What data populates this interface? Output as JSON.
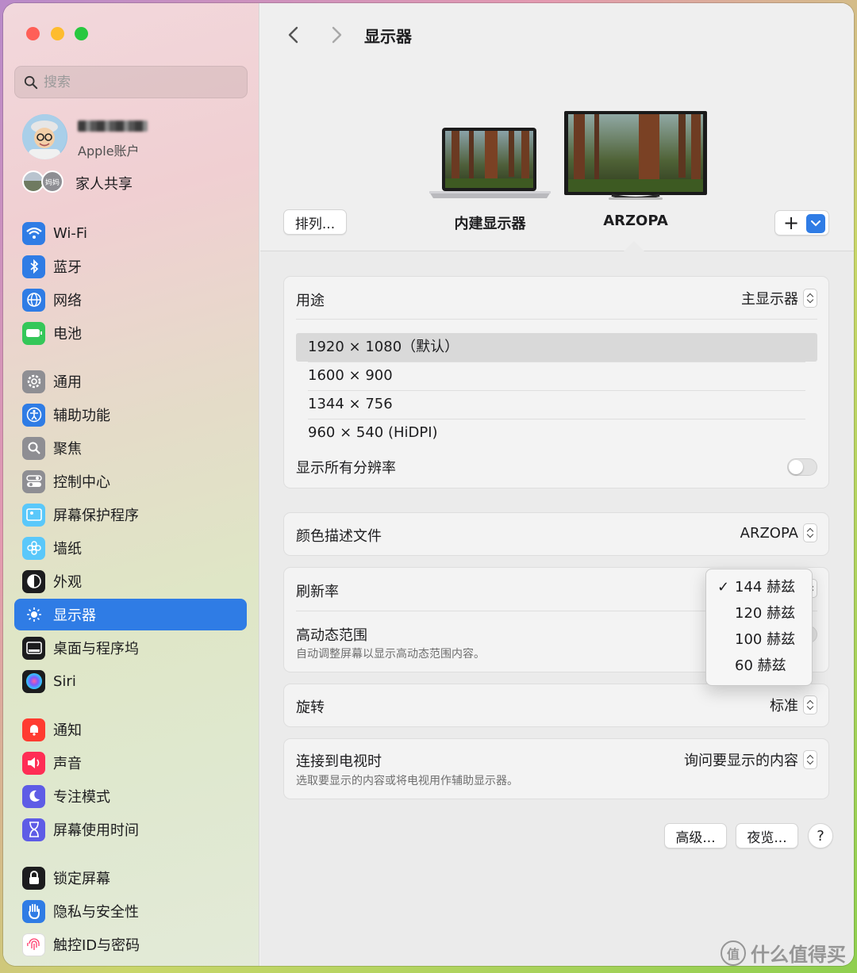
{
  "search": {
    "placeholder": "搜索"
  },
  "account": {
    "subtitle": "Apple账户",
    "family_label": "家人共享",
    "family_badge": "妈妈"
  },
  "sidebar": {
    "items": [
      {
        "label": "Wi-Fi",
        "icon": "wifi-icon",
        "color": "#2f7ce5"
      },
      {
        "label": "蓝牙",
        "icon": "bluetooth-icon",
        "color": "#2f7ce5"
      },
      {
        "label": "网络",
        "icon": "globe-icon",
        "color": "#2f7ce5"
      },
      {
        "label": "电池",
        "icon": "battery-icon",
        "color": "#34c759"
      },
      {
        "label": "通用",
        "icon": "gear-icon",
        "color": "#8e8e93"
      },
      {
        "label": "辅助功能",
        "icon": "accessibility-icon",
        "color": "#2f7ce5"
      },
      {
        "label": "聚焦",
        "icon": "spotlight-icon",
        "color": "#8e8e93"
      },
      {
        "label": "控制中心",
        "icon": "control-center-icon",
        "color": "#8e8e93"
      },
      {
        "label": "屏幕保护程序",
        "icon": "screensaver-icon",
        "color": "#5ac8fa"
      },
      {
        "label": "墙纸",
        "icon": "wallpaper-icon",
        "color": "#5ac8fa"
      },
      {
        "label": "外观",
        "icon": "appearance-icon",
        "color": "#1c1c1e"
      },
      {
        "label": "显示器",
        "icon": "display-icon",
        "color": "#2f7ce5"
      },
      {
        "label": "桌面与程序坞",
        "icon": "dock-icon",
        "color": "#1c1c1e"
      },
      {
        "label": "Siri",
        "icon": "siri-icon",
        "color": "#1c1c1e"
      },
      {
        "label": "通知",
        "icon": "notification-icon",
        "color": "#ff3b30"
      },
      {
        "label": "声音",
        "icon": "sound-icon",
        "color": "#ff2d55"
      },
      {
        "label": "专注模式",
        "icon": "focus-icon",
        "color": "#5e5ce6"
      },
      {
        "label": "屏幕使用时间",
        "icon": "hourglass-icon",
        "color": "#5e5ce6"
      },
      {
        "label": "锁定屏幕",
        "icon": "lock-icon",
        "color": "#1c1c1e"
      },
      {
        "label": "隐私与安全性",
        "icon": "hand-icon",
        "color": "#2f7ce5"
      },
      {
        "label": "触控ID与密码",
        "icon": "fingerprint-icon",
        "color": "#ffffff"
      }
    ],
    "selected": "显示器"
  },
  "header": {
    "title": "显示器"
  },
  "displays": {
    "arrange_label": "排列...",
    "builtin_label": "内建显示器",
    "external_label": "ARZOPA",
    "add_label": "+"
  },
  "usage": {
    "label": "用途",
    "value": "主显示器"
  },
  "resolutions": {
    "options": [
      "1920 × 1080（默认）",
      "1600 × 900",
      "1344 × 756",
      "960 × 540 (HiDPI)"
    ],
    "selected_index": 0,
    "show_all_label": "显示所有分辨率",
    "show_all_on": false
  },
  "color_profile": {
    "label": "颜色描述文件",
    "value": "ARZOPA"
  },
  "refresh": {
    "label": "刷新率",
    "options": [
      "144 赫兹",
      "120 赫兹",
      "100 赫兹",
      "60 赫兹"
    ],
    "selected_index": 0
  },
  "hdr": {
    "label": "高动态范围",
    "description": "自动调整屏幕以显示高动态范围内容。",
    "on": false
  },
  "rotation": {
    "label": "旋转",
    "value": "标准"
  },
  "tv": {
    "label": "连接到电视时",
    "description": "选取要显示的内容或将电视用作辅助显示器。",
    "value": "询问要显示的内容"
  },
  "footer": {
    "advanced_label": "高级...",
    "night_shift_label": "夜览...",
    "help_label": "?"
  },
  "watermark": {
    "text": "什么值得买",
    "badge": "值"
  }
}
